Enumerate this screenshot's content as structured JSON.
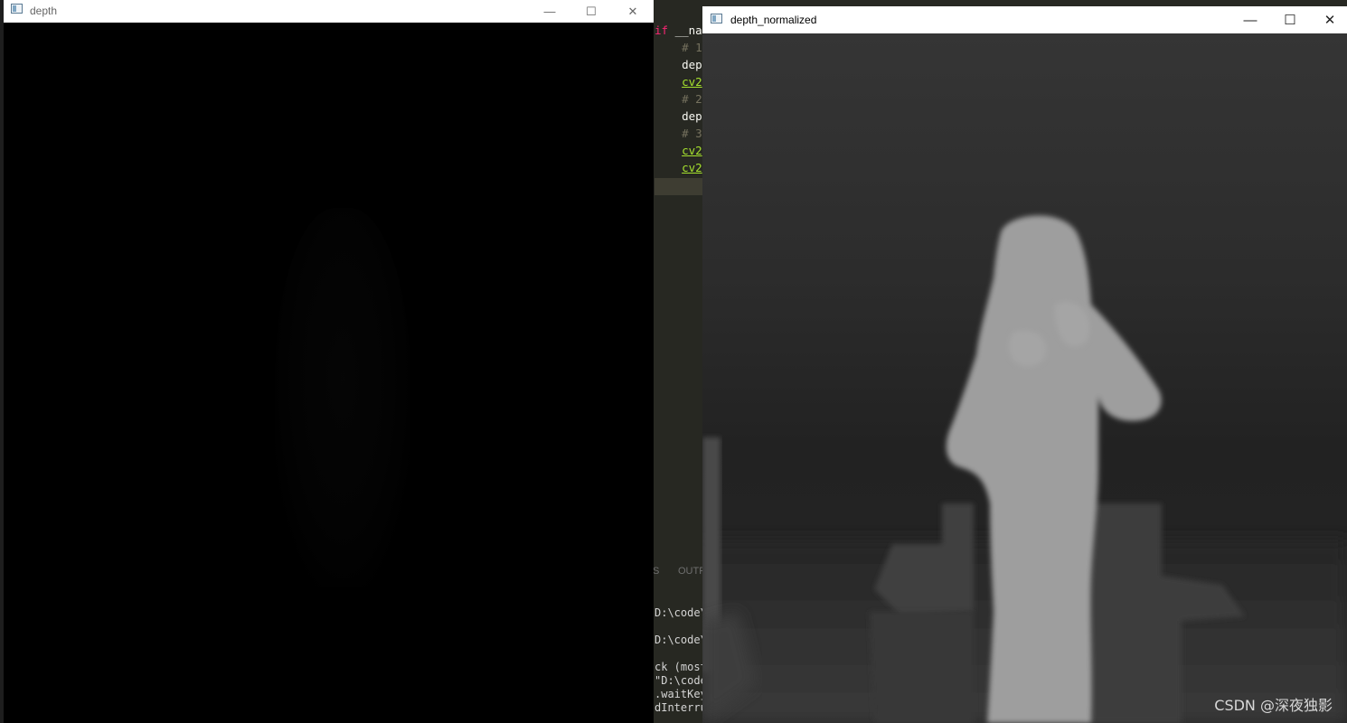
{
  "editor": {
    "code_lines": [
      {
        "segments": [
          {
            "text": "if ",
            "cls": "kw"
          },
          {
            "text": "__na",
            "cls": ""
          }
        ]
      },
      {
        "segments": [
          {
            "text": "    # 1",
            "cls": "cmt"
          }
        ]
      },
      {
        "segments": [
          {
            "text": "    dep",
            "cls": ""
          }
        ]
      },
      {
        "segments": [
          {
            "text": "    ",
            "cls": ""
          },
          {
            "text": "cv2",
            "cls": "fn"
          }
        ]
      },
      {
        "segments": [
          {
            "text": "    # 2",
            "cls": "cmt"
          }
        ]
      },
      {
        "segments": [
          {
            "text": "    dep",
            "cls": ""
          }
        ]
      },
      {
        "segments": [
          {
            "text": "    # 3",
            "cls": "cmt"
          }
        ]
      },
      {
        "segments": [
          {
            "text": "    ",
            "cls": ""
          },
          {
            "text": "cv2",
            "cls": "fn"
          }
        ]
      },
      {
        "segments": [
          {
            "text": "    ",
            "cls": ""
          },
          {
            "text": "cv2",
            "cls": "fn"
          }
        ]
      }
    ],
    "panel_tabs": [
      "S",
      "OUTP"
    ],
    "terminal_lines": [
      "D:\\code\\",
      "",
      "D:\\code\\",
      "",
      "ck (most",
      "\"D:\\code",
      ".waitKey",
      "dInterru"
    ]
  },
  "windows": {
    "depth": {
      "title": "depth",
      "minimize": "—",
      "maximize": "☐",
      "close": "✕"
    },
    "depth_normalized": {
      "title": "depth_normalized",
      "minimize": "—",
      "maximize": "☐",
      "close": "✕"
    }
  },
  "watermark": "CSDN @深夜独影"
}
